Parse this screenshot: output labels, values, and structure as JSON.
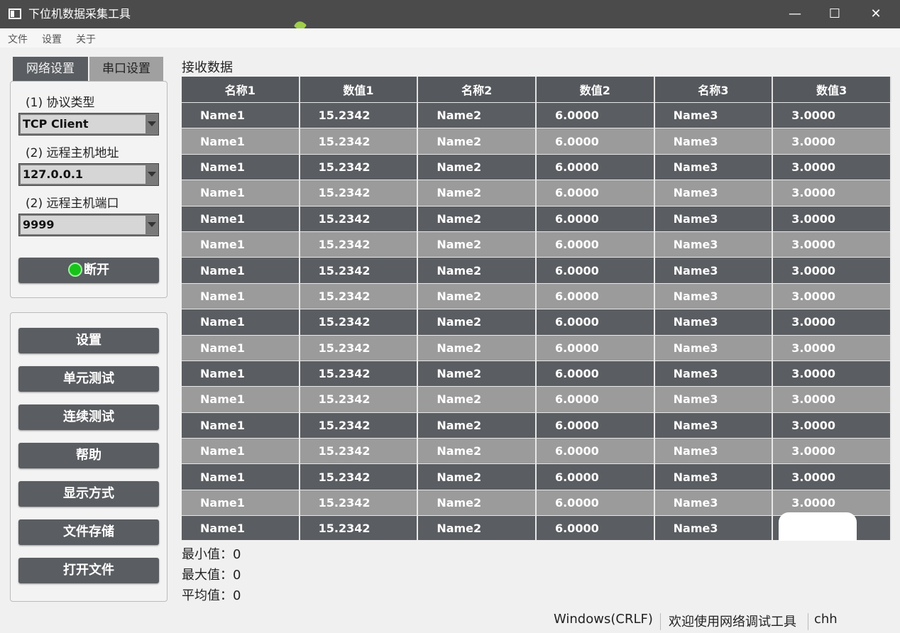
{
  "window": {
    "title": "下位机数据采集工具",
    "minimize": "—",
    "maximize": "☐",
    "close": "✕"
  },
  "menu": [
    "文件",
    "设置",
    "关于"
  ],
  "tabs": {
    "network": "网络设置",
    "serial": "串口设置"
  },
  "network": {
    "protocol_label": "(1) 协议类型",
    "protocol_value": "TCP Client",
    "host_label": "(2) 远程主机地址",
    "host_value": "127.0.0.1",
    "port_label": "(2) 远程主机端口",
    "port_value": "9999",
    "connect_button": "断开",
    "led_color": "#18c21a"
  },
  "actions": [
    "设置",
    "单元测试",
    "连续测试",
    "帮助",
    "显示方式",
    "文件存储",
    "打开文件"
  ],
  "grid": {
    "title": "接收数据",
    "columns": [
      "名称1",
      "数值1",
      "名称2",
      "数值2",
      "名称3",
      "数值3"
    ],
    "rows": [
      [
        "Name1",
        "15.2342",
        "Name2",
        "6.0000",
        "Name3",
        "3.0000"
      ],
      [
        "Name1",
        "15.2342",
        "Name2",
        "6.0000",
        "Name3",
        "3.0000"
      ],
      [
        "Name1",
        "15.2342",
        "Name2",
        "6.0000",
        "Name3",
        "3.0000"
      ],
      [
        "Name1",
        "15.2342",
        "Name2",
        "6.0000",
        "Name3",
        "3.0000"
      ],
      [
        "Name1",
        "15.2342",
        "Name2",
        "6.0000",
        "Name3",
        "3.0000"
      ],
      [
        "Name1",
        "15.2342",
        "Name2",
        "6.0000",
        "Name3",
        "3.0000"
      ],
      [
        "Name1",
        "15.2342",
        "Name2",
        "6.0000",
        "Name3",
        "3.0000"
      ],
      [
        "Name1",
        "15.2342",
        "Name2",
        "6.0000",
        "Name3",
        "3.0000"
      ],
      [
        "Name1",
        "15.2342",
        "Name2",
        "6.0000",
        "Name3",
        "3.0000"
      ],
      [
        "Name1",
        "15.2342",
        "Name2",
        "6.0000",
        "Name3",
        "3.0000"
      ],
      [
        "Name1",
        "15.2342",
        "Name2",
        "6.0000",
        "Name3",
        "3.0000"
      ],
      [
        "Name1",
        "15.2342",
        "Name2",
        "6.0000",
        "Name3",
        "3.0000"
      ],
      [
        "Name1",
        "15.2342",
        "Name2",
        "6.0000",
        "Name3",
        "3.0000"
      ],
      [
        "Name1",
        "15.2342",
        "Name2",
        "6.0000",
        "Name3",
        "3.0000"
      ],
      [
        "Name1",
        "15.2342",
        "Name2",
        "6.0000",
        "Name3",
        "3.0000"
      ],
      [
        "Name1",
        "15.2342",
        "Name2",
        "6.0000",
        "Name3",
        "3.0000"
      ],
      [
        "Name1",
        "15.2342",
        "Name2",
        "6.0000",
        "Name3",
        ""
      ]
    ]
  },
  "stats": {
    "min": "最小值：0",
    "max": "最大值：0",
    "avg": "平均值：0"
  },
  "status": {
    "line_ending": "Windows(CRLF)",
    "message": "欢迎使用网络调试工具",
    "user": "chh"
  }
}
